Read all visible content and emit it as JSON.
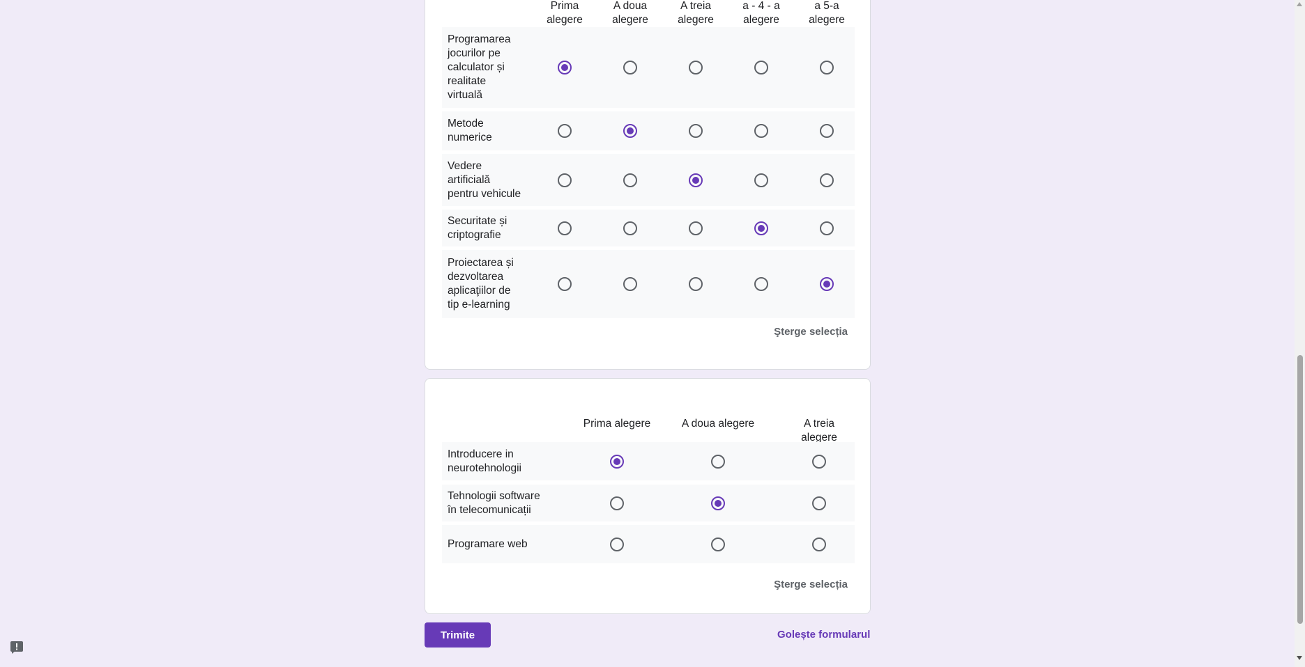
{
  "grid1": {
    "columns": [
      "Prima\nalegere",
      "A doua\nalegere",
      "A treia\nalegere",
      "a - 4 - a\nalegere",
      "a 5-a alegere"
    ],
    "rows": [
      {
        "label": "Programarea jocurilor pe calculator și realitate virtuală",
        "selected": 0
      },
      {
        "label": "Metode numerice",
        "selected": 1
      },
      {
        "label": "Vedere artificială pentru vehicule",
        "selected": 2
      },
      {
        "label": "Securitate și criptografie",
        "selected": 3
      },
      {
        "label": "Proiectarea și dezvoltarea aplicaţiilor de tip e-learning",
        "selected": 4
      }
    ],
    "clear_label": "Şterge selecția"
  },
  "grid2": {
    "columns": [
      "Prima alegere",
      "A doua alegere",
      "A treia alegere"
    ],
    "rows": [
      {
        "label": "Introducere in neurotehnologii",
        "selected": 0
      },
      {
        "label": "Tehnologii software în telecomunicații",
        "selected": 1
      },
      {
        "label": "Programare web",
        "selected": null
      }
    ],
    "clear_label": "Şterge selecția"
  },
  "footer": {
    "submit_label": "Trimite",
    "clear_form_label": "Golește formularul"
  },
  "colors": {
    "accent": "#673ab7",
    "background": "#f0ebf8",
    "radio_border": "#5f6368"
  },
  "icons": {
    "report": "report-problem-icon"
  }
}
